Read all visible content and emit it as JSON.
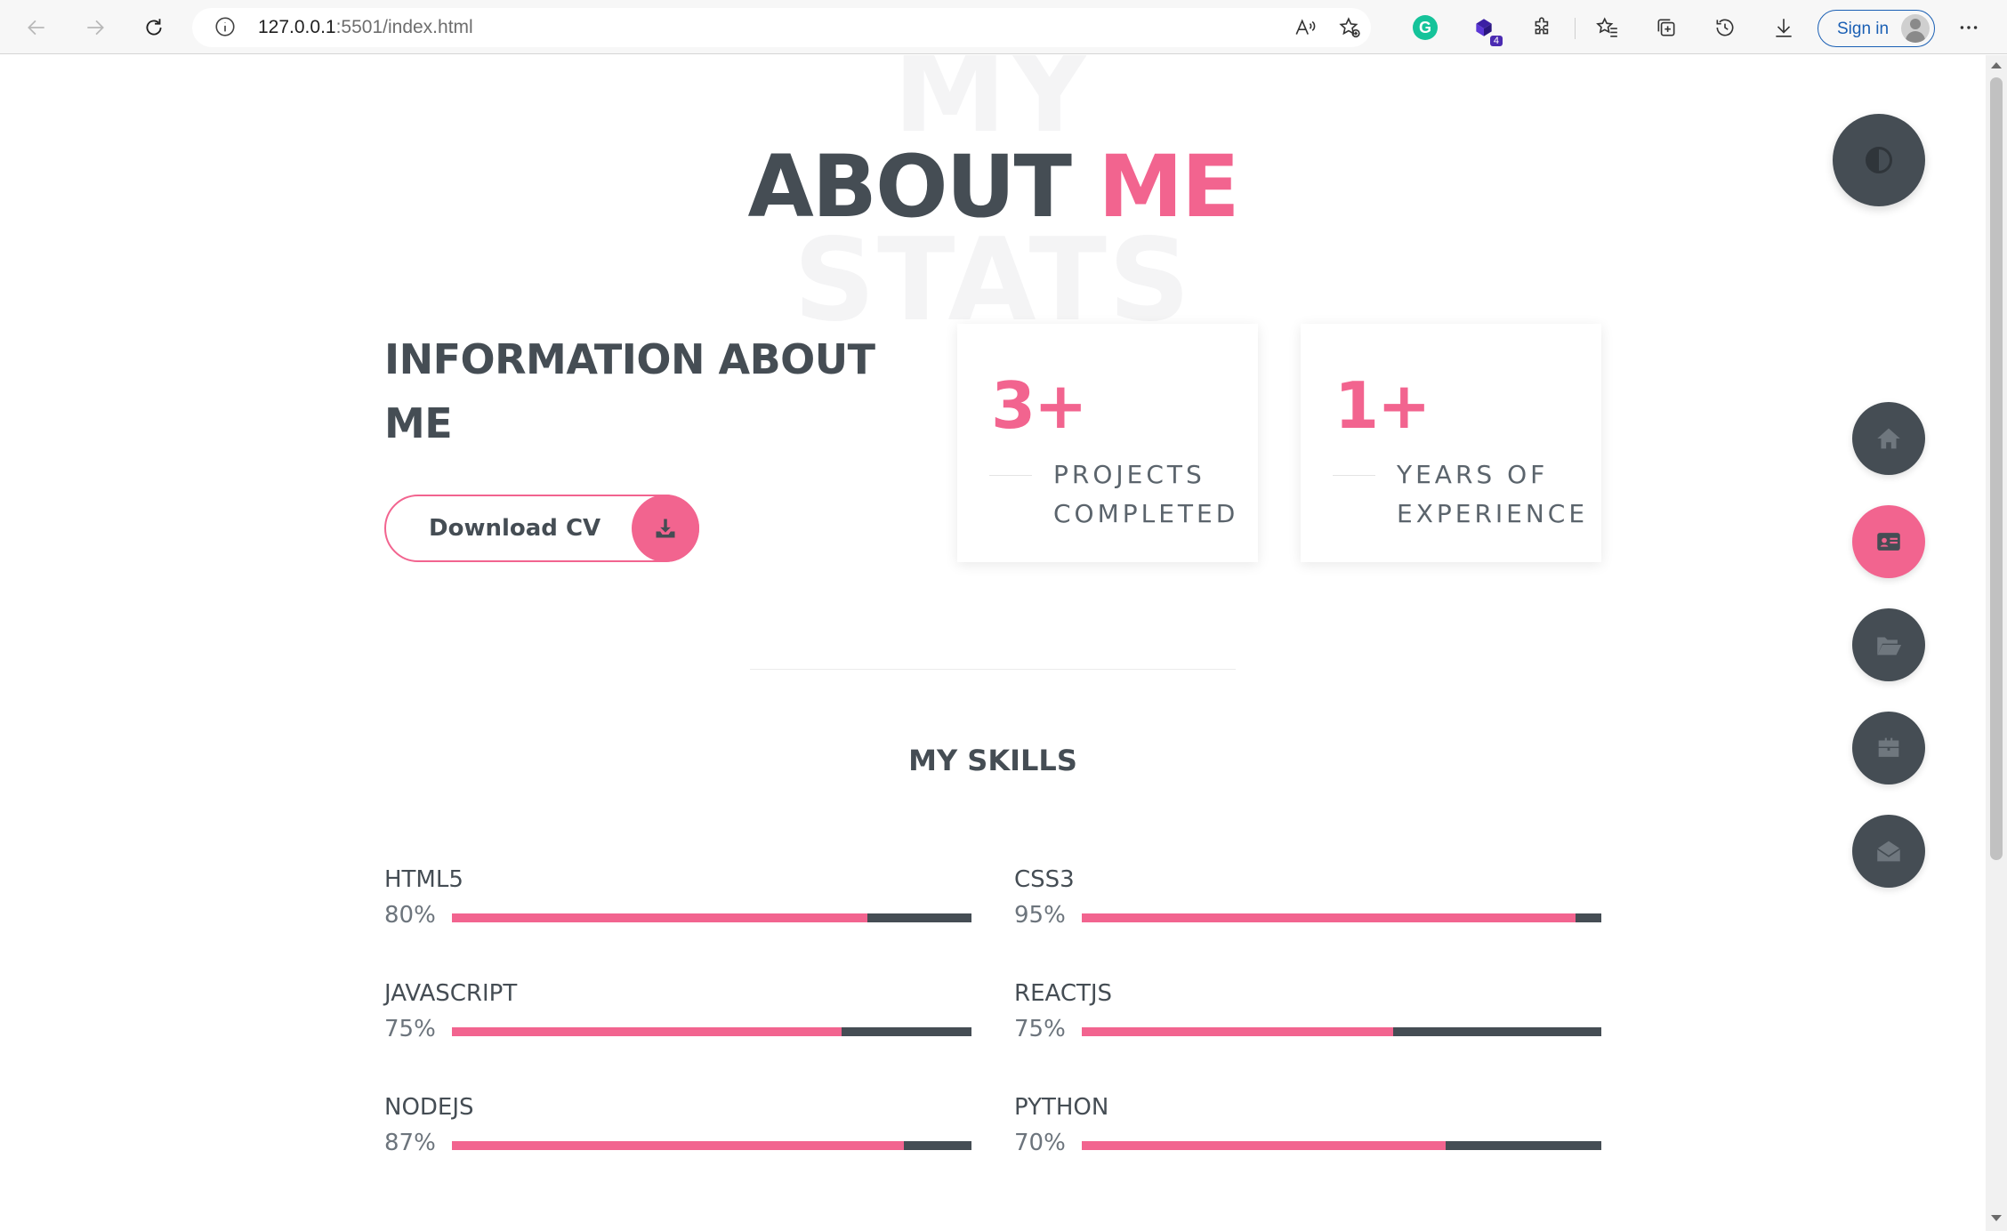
{
  "browser": {
    "url_host": "127.0.0.1",
    "url_rest": ":5501/index.html",
    "extension_badge": "4",
    "signin_label": "Sign in"
  },
  "page": {
    "bg_title_top": "MY",
    "title_main": "ABOUT",
    "title_accent": "ME",
    "bg_title_bottom": "STATS",
    "info_heading": "INFORMATION ABOUT ME",
    "download_label": "Download CV",
    "stats": [
      {
        "number": "3+",
        "label": "PROJECTS COMPLETED"
      },
      {
        "number": "1+",
        "label": "YEARS OF EXPERIENCE"
      }
    ],
    "skills_title": "MY SKILLS",
    "skills": [
      {
        "name": "HTML5",
        "percent_text": "80%",
        "level": 0.8
      },
      {
        "name": "CSS3",
        "percent_text": "95%",
        "level": 0.95
      },
      {
        "name": "JAVASCRIPT",
        "percent_text": "75%",
        "level": 0.75
      },
      {
        "name": "REACTJS",
        "percent_text": "75%",
        "level": 0.6
      },
      {
        "name": "NODEJS",
        "percent_text": "87%",
        "level": 0.87
      },
      {
        "name": "PYTHON",
        "percent_text": "70%",
        "level": 0.7
      }
    ]
  },
  "colors": {
    "accent": "#f2648f",
    "dark": "#454d54",
    "active_nav": "#f2648f"
  },
  "nav_icons": [
    "home-icon",
    "id-card-icon",
    "folder-open-icon",
    "briefcase-icon",
    "envelope-open-icon"
  ],
  "active_nav": "id-card-icon"
}
